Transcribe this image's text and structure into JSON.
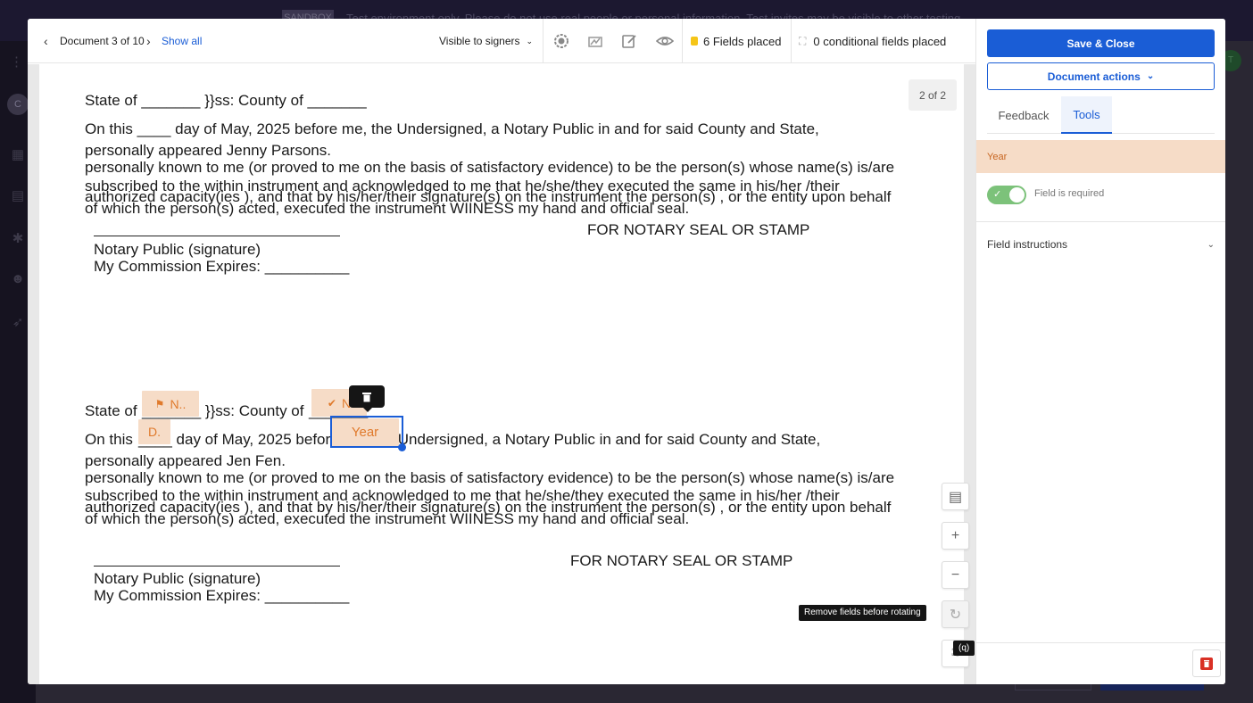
{
  "toolbar": {
    "prev_icon": "chevron-left-icon",
    "document_counter": "Document 3 of 10",
    "next_icon": "chevron-right-icon",
    "show_all": "Show all",
    "visibility": "Visible to signers",
    "fields_placed": "6 Fields placed",
    "conditional_fields": "0 conditional fields placed"
  },
  "page": {
    "indicator": "2 of 2"
  },
  "doc": {
    "block1": {
      "state_line": "State of _______ }}ss: County of _______",
      "on_this": "On this ____ day of May, 2025 before me, the Undersigned, a Notary Public in and for said County and State,",
      "appeared": "personally appeared Jenny Parsons.",
      "known": "personally known to me (or proved to me on the basis of satisfactory evidence) to be the person(s) whose name(s) is/are",
      "subscribed": "subscribed to the within instrument and acknowledged to me that he/she/they executed the same in his/her /their",
      "authorized": "authorized  capacity(ies ), and that by his/her/their signature(s) on the instrument the person(s) , or the entity upon behalf",
      "of_which": "of which the person(s) acted, executed the instrument WIINESS my hand and official seal.",
      "seal": "FOR NOTARY SEAL OR STAMP",
      "notary_sig": "Notary Public (signature)",
      "commission": "My Commission Expires: __________"
    },
    "block2": {
      "state_a": "State of",
      "state_b": "_______ }}ss: County of",
      "state_c": "_______",
      "on_a": "On this",
      "on_b": "____ day of May, 2025 before me, the Undersigned, a Notary Public in and for said County and State,",
      "appeared": "personally appeared Jen Fen.",
      "known": "personally known to me (or proved to me on the basis of satisfactory evidence) to be the person(s) whose name(s) is/are",
      "subscribed": "subscribed to the within instrument and acknowledged to me that he/she/they executed the same in his/her /their",
      "authorized": "authorized  capacity(ies ), and that by his/her/their signature(s) on the instrument the person(s) , or the entity upon behalf",
      "of_which": "of which the person(s) acted, executed the instrument WIINESS my hand and official seal.",
      "seal": "FOR NOTARY SEAL OR STAMP",
      "notary_sig": "Notary Public (signature)",
      "commission": "My Commission Expires: __________"
    }
  },
  "fields": {
    "name_field": "N..",
    "n_field": "N",
    "d_field": "D.",
    "year_field": "Year"
  },
  "tools": {
    "rotate_tooltip": "Remove fields before rotating",
    "fullscreen_shortcut": "(q)"
  },
  "panel": {
    "save_close": "Save & Close",
    "document_actions": "Document actions",
    "tab_feedback": "Feedback",
    "tab_tools": "Tools",
    "field_name": "Year",
    "field_required": "Field is required",
    "field_instructions": "Field instructions"
  },
  "background": {
    "banner_label": "SANDBOX",
    "banner_text": "Test environment only. Please do not use real people or personal information. Test invites may be visible to other testing",
    "avatar_initial": "C",
    "right_avatar": "T"
  },
  "colors": {
    "primary": "#1a5dd6",
    "field_bg": "#f6dcc7",
    "field_text": "#e07a2c",
    "toggle_on": "#7cc27a",
    "delete_red": "#d93025"
  }
}
